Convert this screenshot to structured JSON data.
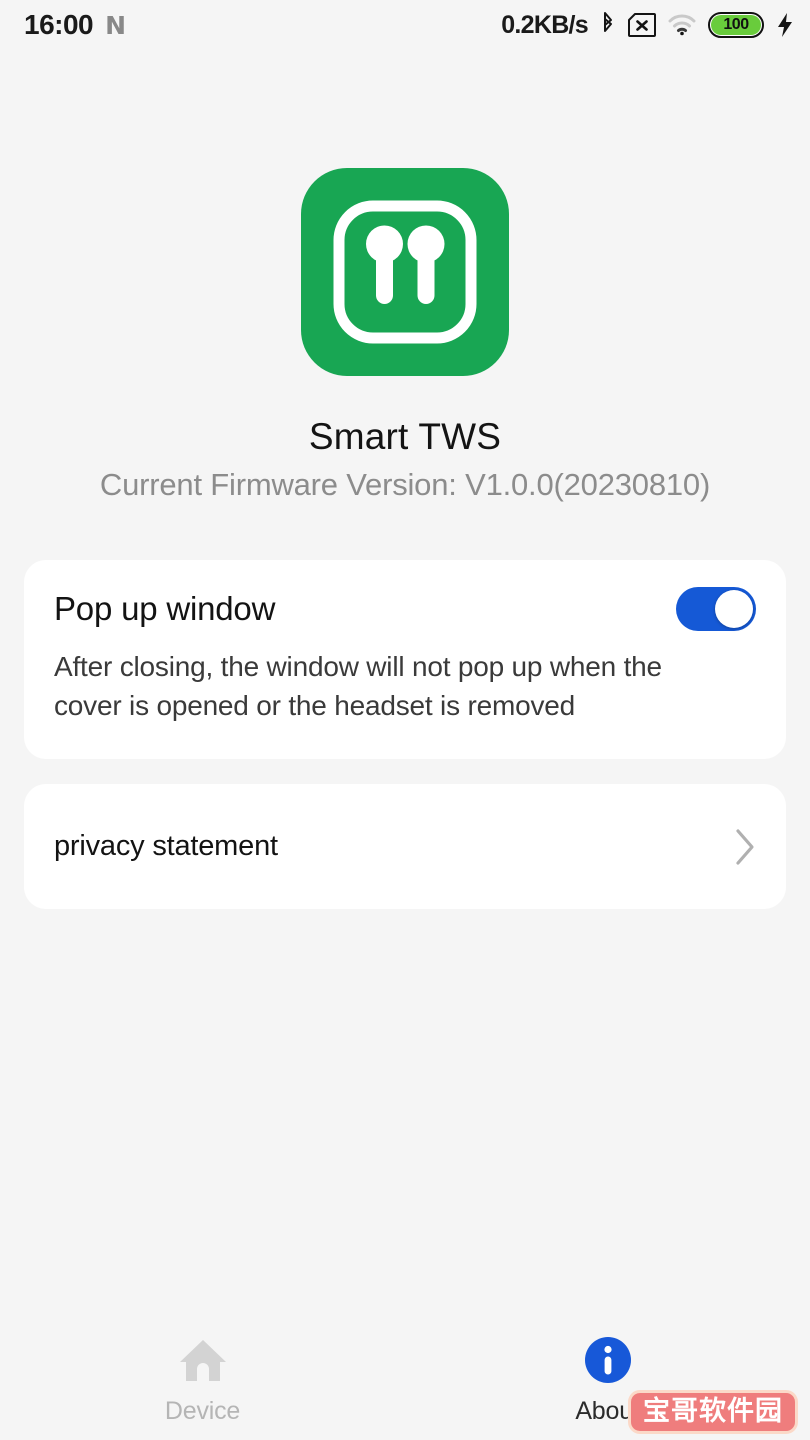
{
  "status_bar": {
    "time": "16:00",
    "nfc_label": "N",
    "net_speed": "0.2KB/s",
    "bluetooth_icon": "bluetooth-icon",
    "sim_icon": "sim-card-no-sim-icon",
    "wifi_icon": "wifi-icon",
    "battery_level": "100",
    "battery_percent": 100,
    "charging_icon": "charging-bolt-icon"
  },
  "header": {
    "app_icon": "earbuds-icon",
    "app_name": "Smart TWS",
    "firmware_version": "Current Firmware Version: V1.0.0(20230810)"
  },
  "settings": {
    "popup": {
      "title": "Pop up window",
      "description": "After closing, the window will not pop up when the cover is opened or the headset is removed",
      "toggle_state": "on"
    },
    "privacy": {
      "label": "privacy statement",
      "chevron_icon": "chevron-right-icon"
    }
  },
  "bottom_nav": {
    "items": [
      {
        "label": "Device",
        "icon": "home-icon",
        "active": false
      },
      {
        "label": "About",
        "icon": "info-circle-icon",
        "active": true
      }
    ]
  },
  "watermark": {
    "text": "宝哥软件园"
  },
  "colors": {
    "page_background": "#f5f5f5",
    "card_background": "#ffffff",
    "brand_green": "#18a653",
    "accent_blue": "#1559d6",
    "battery_green": "#69cc3c",
    "muted_text": "#8c8c8c",
    "watermark_pink": "#ef7d7d"
  }
}
